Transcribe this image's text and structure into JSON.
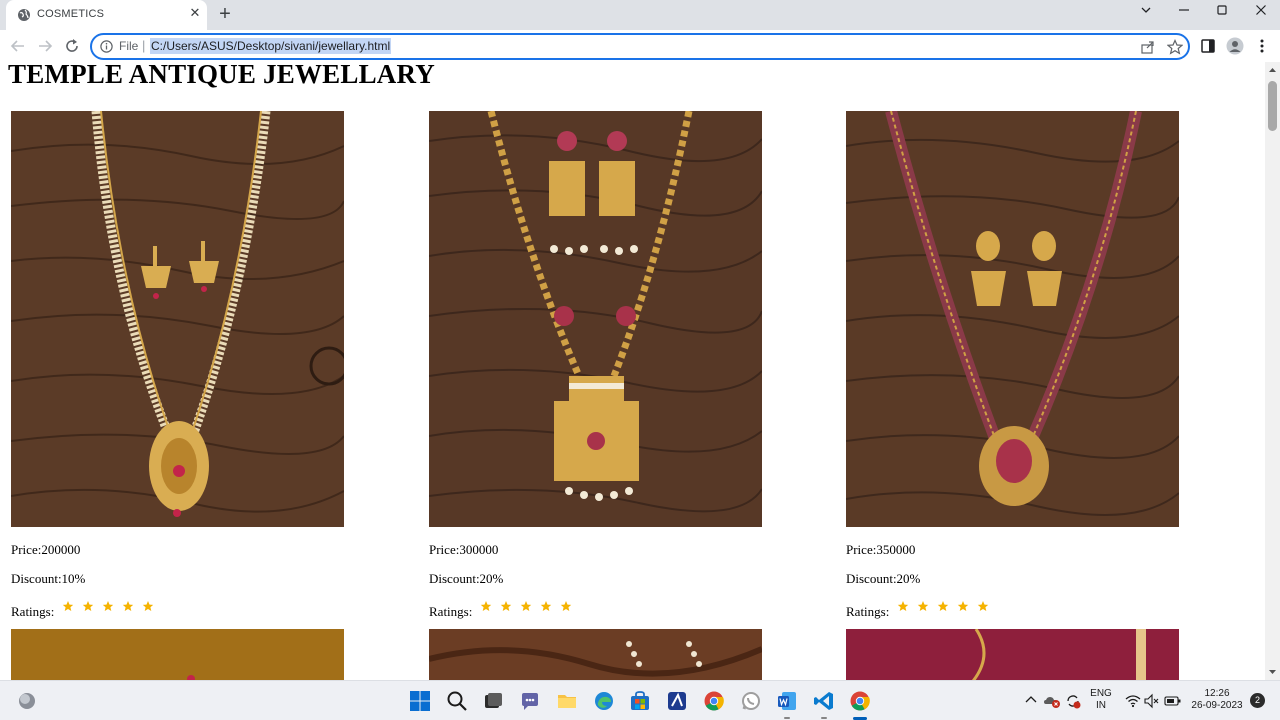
{
  "browser": {
    "tab_title": "COSMETICS",
    "url_scheme": "File",
    "url": "C:/Users/ASUS/Desktop/sivani/jewellary.html"
  },
  "page": {
    "title": "TEMPLE ANTIQUE JEWELLARY",
    "ratings_label": "Ratings:",
    "products": [
      {
        "price": "Price:200000",
        "discount": "Discount:10%",
        "rating_stars": 5
      },
      {
        "price": "Price:300000",
        "discount": "Discount:20%",
        "rating_stars": 5
      },
      {
        "price": "Price:350000",
        "discount": "Discount:20%",
        "rating_stars": 5
      }
    ]
  },
  "taskbar": {
    "language_line1": "ENG",
    "language_line2": "IN",
    "time": "12:26",
    "date": "26-09-2023",
    "notification_count": "2"
  },
  "colors": {
    "accent": "#1a73e8",
    "star": "#f5b301",
    "wood": "#5a3a26"
  }
}
